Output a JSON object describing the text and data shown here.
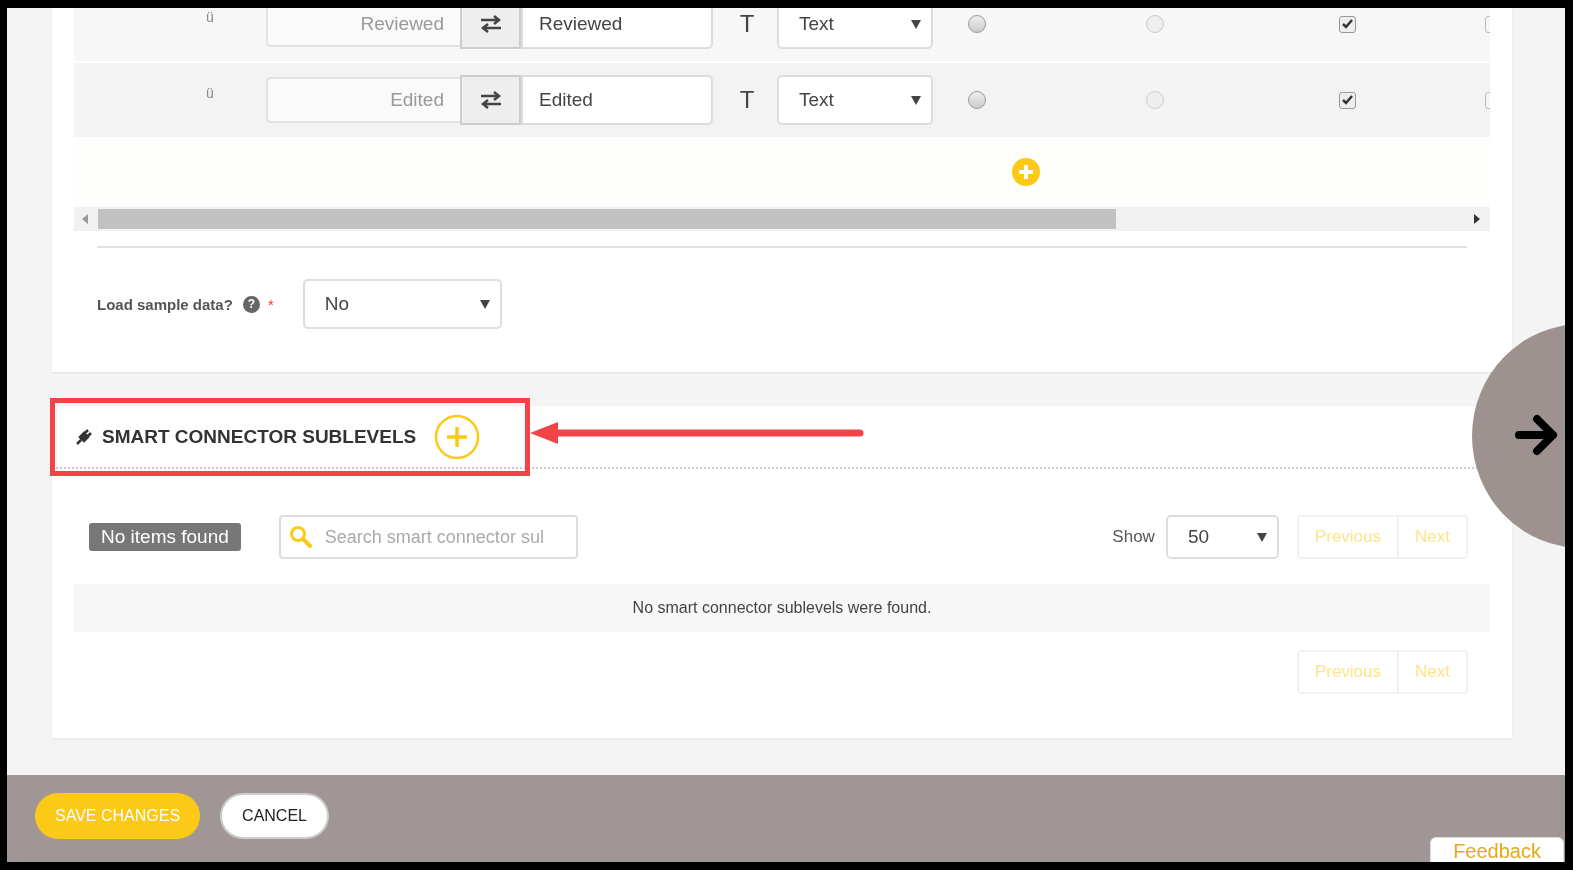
{
  "mapping_table": {
    "rows": [
      {
        "marker": "ü",
        "source": "Reviewed",
        "target": "Reviewed",
        "type_icon": "T",
        "type": "Text",
        "radios": [
          {
            "selected": false,
            "disabled": false
          },
          {
            "selected": false,
            "disabled": true
          }
        ],
        "checkboxes": [
          {
            "checked": true
          },
          {
            "checked": false
          }
        ]
      },
      {
        "marker": "ü",
        "source": "Edited",
        "target": "Edited",
        "type_icon": "T",
        "type": "Text",
        "radios": [
          {
            "selected": false,
            "disabled": false
          },
          {
            "selected": false,
            "disabled": true
          }
        ],
        "checkboxes": [
          {
            "checked": true
          },
          {
            "checked": false
          }
        ]
      }
    ]
  },
  "load_sample": {
    "label": "Load sample data?",
    "help": "?",
    "required": "*",
    "value": "No"
  },
  "sublevels": {
    "title": "SMART CONNECTOR SUBLEVELS",
    "status": "No items found",
    "search": {
      "placeholder": "Search smart connector sul"
    },
    "show_label": "Show",
    "show_value": "50",
    "previous": "Previous",
    "next": "Next",
    "empty_message": "No smart connector sublevels were found.",
    "bottom_previous": "Previous",
    "bottom_next": "Next"
  },
  "footer": {
    "buttons": [
      {
        "label": "SAVE CHANGES",
        "kind": "primary"
      },
      {
        "label": "CANCEL",
        "kind": "secondary"
      }
    ],
    "feedback": "Feedback"
  }
}
